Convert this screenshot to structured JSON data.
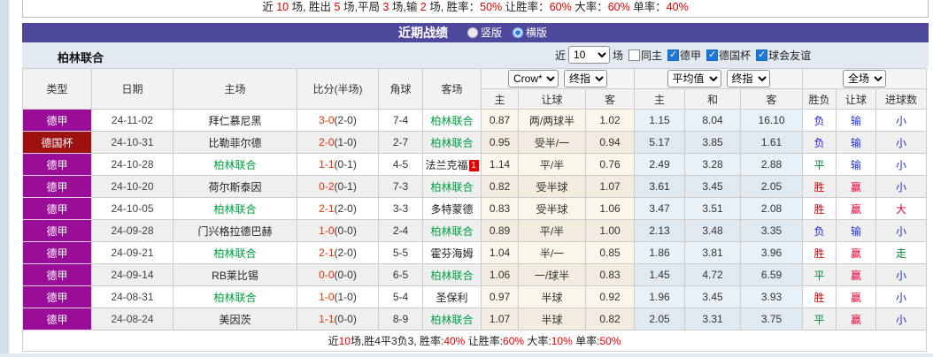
{
  "colors": {
    "accent": "#4e499c",
    "stat_red": "#e60000",
    "filter_bg": "#e3e9f0",
    "league_badge": "#990d99",
    "cup_badge": "#9e1111",
    "tracked_team": "#00a040",
    "score_red": "#ee3000",
    "crow_tint": "#faf6ea",
    "crow_tint_alt": "#f1ecdf",
    "avg_tint": "#e9f1f8",
    "avg_tint_alt": "#e1e9f0"
  },
  "top_stats": {
    "segments": [
      {
        "text": "近 "
      },
      {
        "text": "10",
        "red": true
      },
      {
        "text": " 场, 胜出 "
      },
      {
        "text": "5",
        "red": true
      },
      {
        "text": " 场,平局 "
      },
      {
        "text": "3",
        "red": true
      },
      {
        "text": " 场,输 "
      },
      {
        "text": "2",
        "red": true
      },
      {
        "text": " 场, 胜率："
      },
      {
        "text": "50%",
        "red": true
      },
      {
        "text": " 让胜率："
      },
      {
        "text": "60%",
        "red": true
      },
      {
        "text": " 大率："
      },
      {
        "text": "60%",
        "red": true
      },
      {
        "text": " 单率："
      },
      {
        "text": "40%",
        "red": true
      }
    ]
  },
  "header_bar": {
    "title": "近期战绩",
    "radios": [
      {
        "key": "vertical",
        "label": "竖版",
        "checked": false
      },
      {
        "key": "horizontal",
        "label": "横版",
        "checked": true
      }
    ]
  },
  "filter": {
    "team": "柏林联合",
    "near_label": "近",
    "count": "10",
    "suffix": "场",
    "checkboxes": [
      {
        "key": "same-home",
        "label": "同主",
        "checked": false
      },
      {
        "key": "bundesliga",
        "label": "德甲",
        "checked": true
      },
      {
        "key": "dfb-pokal",
        "label": "德国杯",
        "checked": true
      },
      {
        "key": "club-friendly",
        "label": "球会友谊",
        "checked": true
      }
    ]
  },
  "table": {
    "main_columns": [
      "类型",
      "日期",
      "主场",
      "比分(半场)",
      "角球",
      "客场"
    ],
    "sub_columns": [
      "主",
      "让球",
      "客",
      "主",
      "和",
      "客",
      "胜负",
      "让球",
      "进球数"
    ],
    "selects": {
      "crow_group": [
        {
          "key": "crow-select",
          "value": "Crow*"
        },
        {
          "key": "final-odds-select",
          "value": "终指"
        }
      ],
      "avg_group": [
        {
          "key": "average-select",
          "value": "平均值"
        },
        {
          "key": "final-odds-select-2",
          "value": "终指"
        }
      ],
      "result_group": [
        {
          "key": "full-match-select",
          "value": "全场"
        }
      ]
    },
    "outcome_colors": {
      "胜": "#e60000",
      "平": "#008833",
      "负": "#2222cc",
      "赢": "#e60033",
      "输": "#2233cc",
      "走": "#008833",
      "大": "#e60033",
      "小": "#2233cc"
    },
    "rows": [
      {
        "league": "德甲",
        "league_type": "league",
        "date": "24-11-02",
        "home": "拜仁慕尼黑",
        "home_tracked": false,
        "score": "3-0",
        "half": "(2-0)",
        "corners": "7-4",
        "away": "柏林联合",
        "away_tracked": true,
        "away_card": "",
        "crow": [
          "0.87",
          "两/两球半",
          "1.02"
        ],
        "avg": [
          "1.15",
          "8.04",
          "16.10"
        ],
        "outcomes": [
          "负",
          "输",
          "小"
        ]
      },
      {
        "league": "德国杯",
        "league_type": "cup",
        "date": "24-10-31",
        "home": "比勒菲尔德",
        "home_tracked": false,
        "score": "2-0",
        "half": "(1-0)",
        "corners": "2-7",
        "away": "柏林联合",
        "away_tracked": true,
        "away_card": "",
        "crow": [
          "0.95",
          "受半/一",
          "0.94"
        ],
        "avg": [
          "5.17",
          "3.85",
          "1.61"
        ],
        "outcomes": [
          "负",
          "输",
          "小"
        ]
      },
      {
        "league": "德甲",
        "league_type": "league",
        "date": "24-10-28",
        "home": "柏林联合",
        "home_tracked": true,
        "score": "1-1",
        "half": "(0-1)",
        "corners": "4-5",
        "away": "法兰克福",
        "away_tracked": false,
        "away_card": "1",
        "crow": [
          "1.14",
          "平/半",
          "0.76"
        ],
        "avg": [
          "2.49",
          "3.28",
          "2.88"
        ],
        "outcomes": [
          "平",
          "输",
          "小"
        ]
      },
      {
        "league": "德甲",
        "league_type": "league",
        "date": "24-10-20",
        "home": "荷尔斯泰因",
        "home_tracked": false,
        "score": "0-2",
        "half": "(0-1)",
        "corners": "7-3",
        "away": "柏林联合",
        "away_tracked": true,
        "away_card": "",
        "crow": [
          "0.82",
          "受半球",
          "1.07"
        ],
        "avg": [
          "3.61",
          "3.45",
          "2.05"
        ],
        "outcomes": [
          "胜",
          "赢",
          "小"
        ]
      },
      {
        "league": "德甲",
        "league_type": "league",
        "date": "24-10-05",
        "home": "柏林联合",
        "home_tracked": true,
        "score": "2-1",
        "half": "(2-0)",
        "corners": "3-3",
        "away": "多特蒙德",
        "away_tracked": false,
        "away_card": "",
        "crow": [
          "0.83",
          "受半球",
          "1.06"
        ],
        "avg": [
          "3.47",
          "3.51",
          "2.08"
        ],
        "outcomes": [
          "胜",
          "赢",
          "大"
        ]
      },
      {
        "league": "德甲",
        "league_type": "league",
        "date": "24-09-28",
        "home": "门兴格拉德巴赫",
        "home_tracked": false,
        "score": "1-0",
        "half": "(0-0)",
        "corners": "2-4",
        "away": "柏林联合",
        "away_tracked": true,
        "away_card": "",
        "crow": [
          "0.89",
          "平/半",
          "1.00"
        ],
        "avg": [
          "2.13",
          "3.48",
          "3.35"
        ],
        "outcomes": [
          "负",
          "输",
          "小"
        ]
      },
      {
        "league": "德甲",
        "league_type": "league",
        "date": "24-09-21",
        "home": "柏林联合",
        "home_tracked": true,
        "score": "2-1",
        "half": "(2-0)",
        "corners": "5-5",
        "away": "霍芬海姆",
        "away_tracked": false,
        "away_card": "",
        "crow": [
          "1.04",
          "半/一",
          "0.85"
        ],
        "avg": [
          "1.86",
          "3.81",
          "3.96"
        ],
        "outcomes": [
          "胜",
          "赢",
          "走"
        ]
      },
      {
        "league": "德甲",
        "league_type": "league",
        "date": "24-09-14",
        "home": "RB莱比锡",
        "home_tracked": false,
        "score": "0-0",
        "half": "(0-0)",
        "corners": "6-5",
        "away": "柏林联合",
        "away_tracked": true,
        "away_card": "",
        "crow": [
          "1.06",
          "一/球半",
          "0.83"
        ],
        "avg": [
          "1.45",
          "4.72",
          "6.59"
        ],
        "outcomes": [
          "平",
          "赢",
          "小"
        ]
      },
      {
        "league": "德甲",
        "league_type": "league",
        "date": "24-08-31",
        "home": "柏林联合",
        "home_tracked": true,
        "score": "1-0",
        "half": "(1-0)",
        "corners": "5-4",
        "away": "圣保利",
        "away_tracked": false,
        "away_card": "",
        "crow": [
          "0.97",
          "半球",
          "0.92"
        ],
        "avg": [
          "1.96",
          "3.45",
          "3.93"
        ],
        "outcomes": [
          "胜",
          "赢",
          "小"
        ]
      },
      {
        "league": "德甲",
        "league_type": "league",
        "date": "24-08-24",
        "home": "美因茨",
        "home_tracked": false,
        "score": "1-1",
        "half": "(0-0)",
        "corners": "8-9",
        "away": "柏林联合",
        "away_tracked": true,
        "away_card": "",
        "crow": [
          "1.07",
          "半球",
          "0.82"
        ],
        "avg": [
          "2.05",
          "3.31",
          "3.75"
        ],
        "outcomes": [
          "平",
          "赢",
          "小"
        ]
      }
    ]
  },
  "bottom_stats": {
    "segments": [
      {
        "text": "近"
      },
      {
        "text": "10",
        "red": true
      },
      {
        "text": "场,胜4平3负3, 胜率:"
      },
      {
        "text": "40%",
        "red": true
      },
      {
        "text": " 让胜率:"
      },
      {
        "text": "60%",
        "red": true
      },
      {
        "text": " 大率:"
      },
      {
        "text": "10%",
        "red": true
      },
      {
        "text": " 单率:"
      },
      {
        "text": "50%",
        "red": true
      }
    ]
  }
}
